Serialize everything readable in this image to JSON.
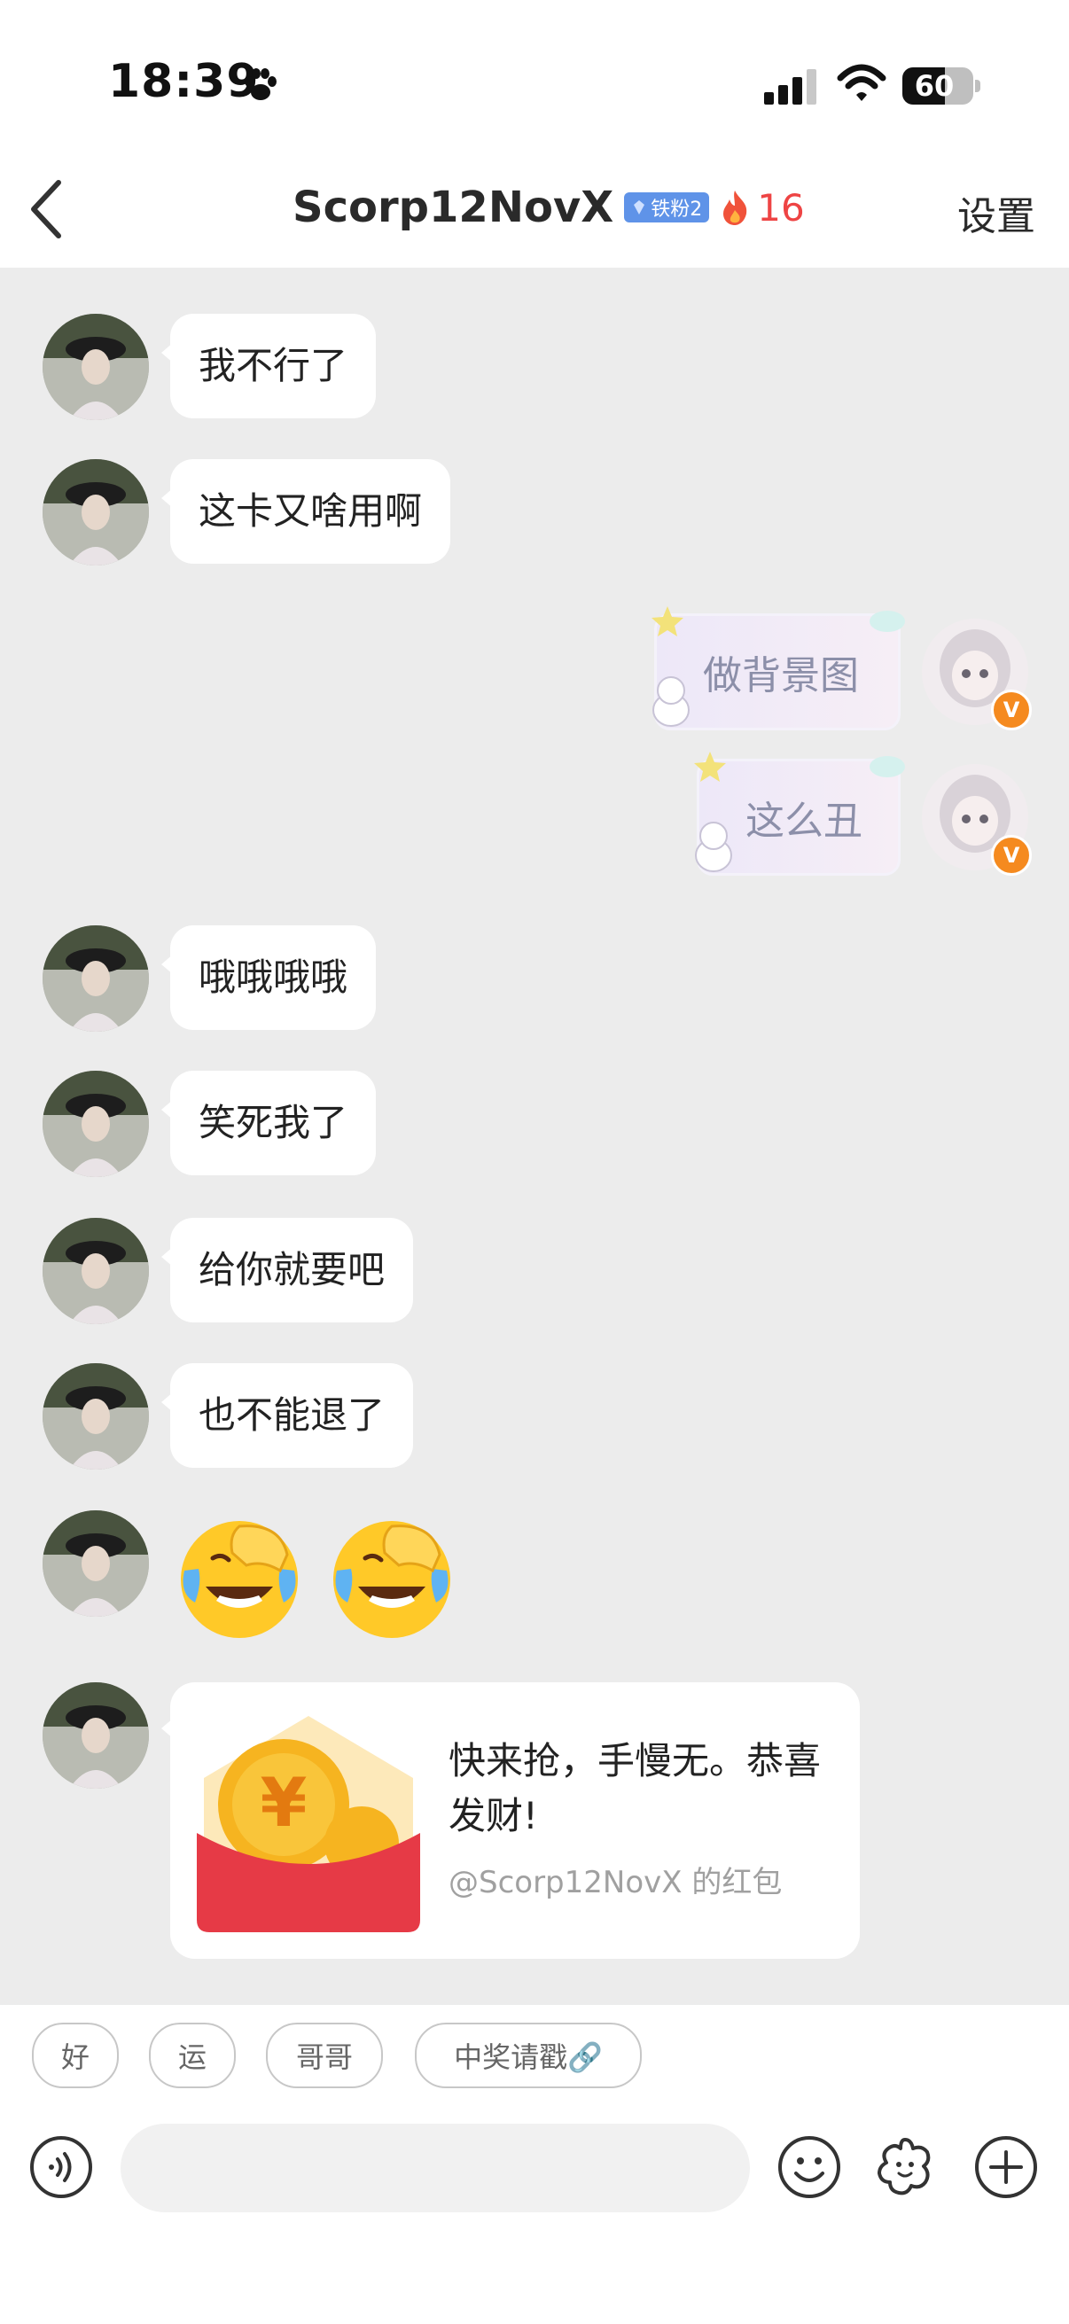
{
  "status_bar": {
    "time": "18:39",
    "battery": "60",
    "battery_level_percent": 60
  },
  "header": {
    "title": "Scorp12NovX",
    "fan_badge": "铁粉2",
    "streak_count": "16",
    "settings_label": "设置"
  },
  "messages": [
    {
      "side": "left",
      "type": "text",
      "text": "我不行了"
    },
    {
      "side": "left",
      "type": "text",
      "text": "这卡又啥用啊"
    },
    {
      "side": "right",
      "type": "decorated_text",
      "text": "做背景图"
    },
    {
      "side": "right",
      "type": "decorated_text",
      "text": "这么丑"
    },
    {
      "side": "left",
      "type": "text",
      "text": "哦哦哦哦"
    },
    {
      "side": "left",
      "type": "text",
      "text": "笑死我了"
    },
    {
      "side": "left",
      "type": "text",
      "text": "给你就要吧"
    },
    {
      "side": "left",
      "type": "text",
      "text": "也不能退了"
    },
    {
      "side": "left",
      "type": "emoji",
      "emoji": [
        "laughing-crying-emoji",
        "laughing-crying-emoji"
      ]
    },
    {
      "side": "left",
      "type": "red_packet",
      "message": "快来抢，手慢无。恭喜发财!",
      "from": "@Scorp12NovX 的红包"
    }
  ],
  "quick_replies": [
    "好",
    "运",
    "哥哥",
    "中奖请戳🔗"
  ],
  "input_bar": {
    "icons": [
      "voice-icon",
      "emoji-icon",
      "sticker-icon",
      "plus-icon"
    ]
  },
  "colors": {
    "accent_red": "#e63a46",
    "badge_blue": "#5f93e8",
    "verified_orange": "#f58a1f",
    "chat_bg": "#ececec"
  }
}
